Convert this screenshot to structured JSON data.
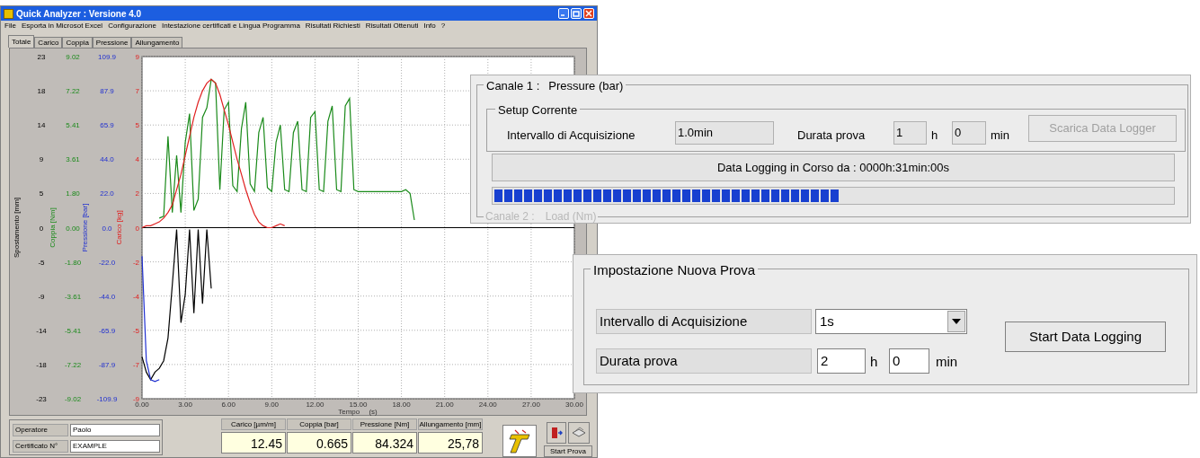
{
  "window": {
    "title": "Quick Analyzer : Versione 4.0"
  },
  "menu": [
    "File",
    "Esporta in Microsot Excel",
    "Configurazione",
    "Intestazione certificati e Lingua Programma",
    "Risultati Richiesti",
    "Risultati Ottenuti",
    "Info",
    "?"
  ],
  "tabs": [
    {
      "label": "Totale",
      "selected": true
    },
    {
      "label": "Carico",
      "selected": false
    },
    {
      "label": "Coppia",
      "selected": false
    },
    {
      "label": "Pressione",
      "selected": false
    },
    {
      "label": "Allungamento",
      "selected": false
    }
  ],
  "plot": {
    "axes": [
      {
        "title": "Spostamento [mm]",
        "ticks": [
          "23",
          "18",
          "14",
          "9",
          "5",
          "0",
          "-5",
          "-9",
          "-14",
          "-18",
          "-23"
        ]
      },
      {
        "title": "Coppia [Nm]",
        "ticks": [
          "9.02",
          "7.22",
          "5.41",
          "3.61",
          "1.80",
          "0.00",
          "-1.80",
          "-3.61",
          "-5.41",
          "-7.22",
          "-9.02"
        ]
      },
      {
        "title": "Pressione [bar]",
        "ticks": [
          "109.9",
          "87.9",
          "65.9",
          "44.0",
          "22.0",
          "0.0",
          "-22.0",
          "-44.0",
          "-65.9",
          "-87.9",
          "-109.9"
        ]
      }
    ],
    "chart_data": {
      "type": "line",
      "grid": true,
      "xlabel": "Tempo (s)",
      "ylabel": "Carico [kg]",
      "xlim": [
        0,
        30
      ],
      "ylim": [
        -9,
        9
      ],
      "xticks": [
        {
          "value": 0,
          "label": "0.00"
        },
        {
          "value": 3,
          "label": "3.00"
        },
        {
          "value": 6,
          "label": "6.00"
        },
        {
          "value": 9,
          "label": "9.00"
        },
        {
          "value": 12,
          "label": "12.00"
        },
        {
          "value": 15,
          "label": "15.00"
        },
        {
          "value": 18,
          "label": "18.00"
        },
        {
          "value": 21,
          "label": "21.00"
        },
        {
          "value": 24,
          "label": "24.00"
        },
        {
          "value": 27,
          "label": "27.00"
        },
        {
          "value": 30,
          "label": "30.00"
        }
      ],
      "yticks": [
        {
          "value": 9,
          "label": "9"
        },
        {
          "value": 7.2,
          "label": "7"
        },
        {
          "value": 5.4,
          "label": "5"
        },
        {
          "value": 3.6,
          "label": "4"
        },
        {
          "value": 1.8,
          "label": "2"
        },
        {
          "value": 0,
          "label": "0"
        },
        {
          "value": -1.8,
          "label": "-2"
        },
        {
          "value": -3.6,
          "label": "-4"
        },
        {
          "value": -5.4,
          "label": "-5"
        },
        {
          "value": -7.2,
          "label": "-7"
        },
        {
          "value": -9,
          "label": "-9"
        }
      ],
      "x": [
        0,
        0.3,
        0.6,
        0.9,
        1.2,
        1.5,
        1.8,
        2.1,
        2.4,
        2.7,
        3,
        3.3,
        3.6,
        3.9,
        4.2,
        4.5,
        4.8,
        5.1,
        5.4,
        5.7,
        6,
        6.3,
        6.6,
        6.9,
        7.2,
        7.5,
        7.8,
        8.1,
        8.4,
        8.7,
        9,
        9.3,
        9.6,
        9.9,
        10.2,
        10.5,
        10.8,
        11.1,
        11.4,
        11.7,
        12,
        12.3,
        12.6,
        12.9,
        13.2,
        13.5,
        13.8,
        14.1,
        14.4,
        14.7,
        15,
        15.3,
        15.6,
        15.9,
        16.2,
        16.5,
        16.8,
        17.1,
        17.4,
        17.7,
        18,
        18.3,
        18.6,
        18.9
      ],
      "series": [
        {
          "color": "#000000",
          "values": [
            -6.8,
            -7.6,
            -8.0,
            -7.6,
            -7.4,
            -7.0,
            -5.8,
            -3.0,
            -0.1,
            -5.0,
            -3.5,
            -0.1,
            -4.5,
            -0.1,
            -4.0,
            -0.1,
            -3.2,
            null,
            null,
            null,
            null,
            null,
            null,
            null,
            null,
            null,
            null,
            null,
            null,
            null,
            null,
            null,
            null,
            null,
            null,
            null,
            null,
            null,
            null,
            null,
            null,
            null,
            null,
            null,
            null,
            null,
            null,
            null,
            null,
            null,
            null,
            null,
            null,
            null,
            null,
            null,
            null,
            null,
            null,
            null,
            null,
            null,
            null,
            null
          ]
        },
        {
          "color": "#1a8a1a",
          "values": [
            null,
            null,
            null,
            null,
            0.5,
            0.6,
            4.8,
            0.8,
            3.8,
            0.8,
            4.5,
            6.0,
            0.9,
            1.5,
            5.8,
            6.3,
            7.8,
            7.6,
            2.0,
            6.2,
            6.6,
            2.2,
            1.9,
            5.2,
            6.6,
            2.3,
            1.9,
            5.0,
            5.8,
            2.1,
            1.9,
            4.5,
            5.4,
            2.0,
            1.9,
            5.0,
            5.6,
            2.0,
            1.9,
            5.8,
            6.1,
            2.0,
            1.9,
            5.6,
            6.4,
            2.0,
            1.9,
            6.4,
            6.8,
            2.0,
            1.9,
            1.9,
            1.9,
            1.9,
            1.9,
            1.9,
            1.9,
            1.9,
            1.9,
            1.9,
            1.9,
            2.0,
            1.8,
            0.4
          ]
        },
        {
          "color": "#2030d0",
          "values": [
            -1.5,
            -7.0,
            -8.0,
            -8.1,
            -8.0,
            null,
            null,
            null,
            null,
            null,
            null,
            null,
            null,
            null,
            null,
            null,
            null,
            null,
            null,
            null,
            null,
            null,
            null,
            null,
            null,
            null,
            null,
            null,
            null,
            null,
            null,
            null,
            null,
            null,
            null,
            null,
            null,
            null,
            null,
            null,
            null,
            null,
            null,
            null,
            null,
            null,
            null,
            null,
            null,
            null,
            null,
            null,
            null,
            null,
            null,
            null,
            null,
            null,
            null,
            null,
            null,
            null,
            null,
            null
          ]
        },
        {
          "color": "#e02020",
          "values": [
            0,
            0.1,
            0.1,
            0.2,
            0.3,
            0.5,
            0.8,
            1.2,
            2.0,
            2.8,
            3.8,
            4.8,
            5.8,
            6.6,
            7.2,
            7.6,
            7.8,
            7.6,
            7.0,
            6.2,
            5.4,
            4.5,
            3.6,
            2.8,
            2.0,
            1.3,
            0.7,
            0.3,
            0.1,
            0.0,
            0.0,
            0.1,
            0.2,
            0.1,
            null,
            null,
            null,
            null,
            null,
            null,
            null,
            null,
            null,
            null,
            null,
            null,
            null,
            null,
            null,
            null,
            null,
            null,
            null,
            null,
            null,
            null,
            null,
            null,
            null,
            null,
            null,
            null,
            null,
            null
          ]
        }
      ]
    }
  },
  "operator": {
    "label": "Operatore",
    "value": "Paolo"
  },
  "certificate": {
    "label": "Certificato N°",
    "value": "EXAMPLE"
  },
  "readouts": [
    {
      "label": "Carico [µm/m]",
      "value": "12.45"
    },
    {
      "label": "Coppia [bar]",
      "value": "0.665"
    },
    {
      "label": "Pressione [Nm]",
      "value": "84.324"
    },
    {
      "label": "Allungamento [mm]",
      "value": "25,78"
    }
  ],
  "start_button": "Start Prova",
  "channel_panel": {
    "title": "Canale 1 :",
    "channel": "Pressure (bar)",
    "setup_title": "Setup Corrente",
    "interval_label": "Intervallo di Acquisizione",
    "interval_value": "1.0min",
    "duration_label": "Durata prova",
    "hours": "1",
    "h_unit": "h",
    "minutes": "0",
    "min_unit": "min",
    "download_button": {
      "label": "Scarica Data Logger",
      "disabled": true
    },
    "status": "Data Logging in Corso da : 0000h:31min:00s",
    "level": 0.51,
    "next_channel": "Canale 2 :",
    "next_channel_name": "Load (Nm)"
  },
  "new_test_panel": {
    "title": "Impostazione Nuova Prova",
    "interval_label": "Intervallo di Acquisizione",
    "interval_value": "1s",
    "duration_label": "Durata prova",
    "hours": "2",
    "h_unit": "h",
    "minutes": "0",
    "min_unit": "min",
    "start_button": "Start Data Logging"
  }
}
